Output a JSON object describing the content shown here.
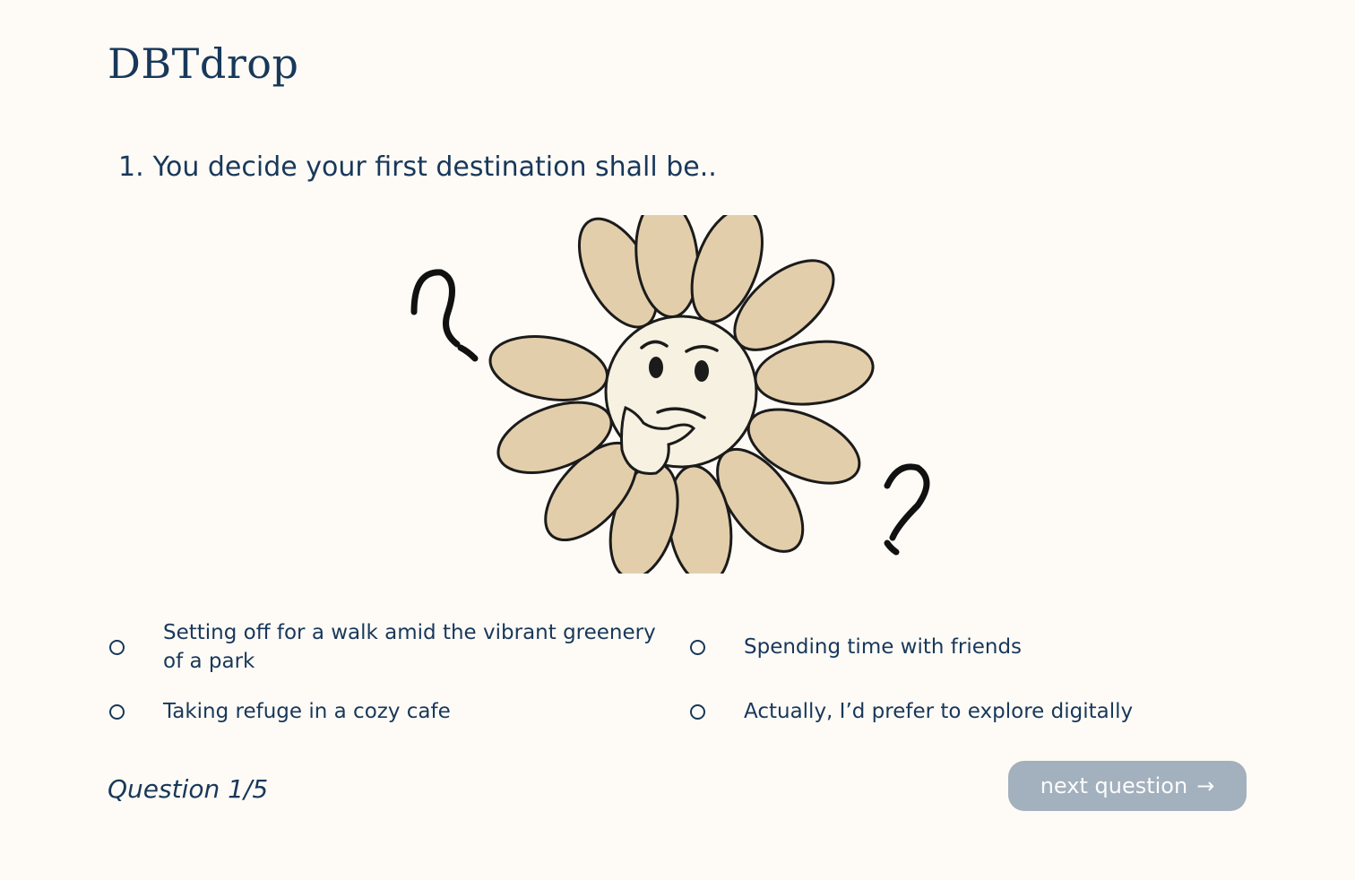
{
  "app": {
    "title": "DBTdrop"
  },
  "question": {
    "number": "1.",
    "text": "You decide your first destination shall be.."
  },
  "illustration": {
    "description_icon": "thinking-flower-icon"
  },
  "options": [
    {
      "label": "Setting off for a walk amid the vibrant greenery of a park",
      "selected": false
    },
    {
      "label": "Spending time with friends",
      "selected": false
    },
    {
      "label": "Taking refuge in a cozy cafe",
      "selected": false
    },
    {
      "label": "Actually, I’d prefer to explore digitally",
      "selected": false
    }
  ],
  "progress": {
    "text": "Question 1/5"
  },
  "next_button": {
    "label": "next question",
    "arrow": "→"
  },
  "colors": {
    "background": "#fefbf6",
    "text": "#18385a",
    "button_disabled": "#a3b0bd",
    "petal": "#e3ceac",
    "flower_center": "#f6f1e1"
  }
}
